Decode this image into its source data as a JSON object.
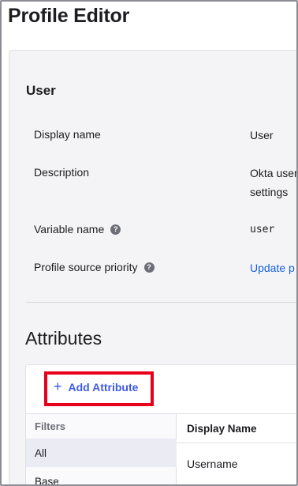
{
  "page": {
    "title": "Profile Editor"
  },
  "profile": {
    "section_title": "User",
    "rows": [
      {
        "label": "Display name",
        "value": "User"
      },
      {
        "label": "Description",
        "value_line1": "Okta user",
        "value_line2": "settings"
      },
      {
        "label": "Variable name",
        "value": "user",
        "help_icon": "help-icon"
      },
      {
        "label": "Profile source priority",
        "value": "Update p",
        "help_icon": "help-icon"
      }
    ]
  },
  "attributes": {
    "title": "Attributes",
    "add_button_label": "Add Attribute",
    "filters_header": "Filters",
    "filters": [
      "All",
      "Base"
    ],
    "columns": [
      "Display Name"
    ],
    "rows": [
      {
        "display_name": "Username"
      }
    ]
  },
  "colors": {
    "link": "#1662dd",
    "accent": "#3f59e4",
    "highlight": "#e8001c"
  }
}
